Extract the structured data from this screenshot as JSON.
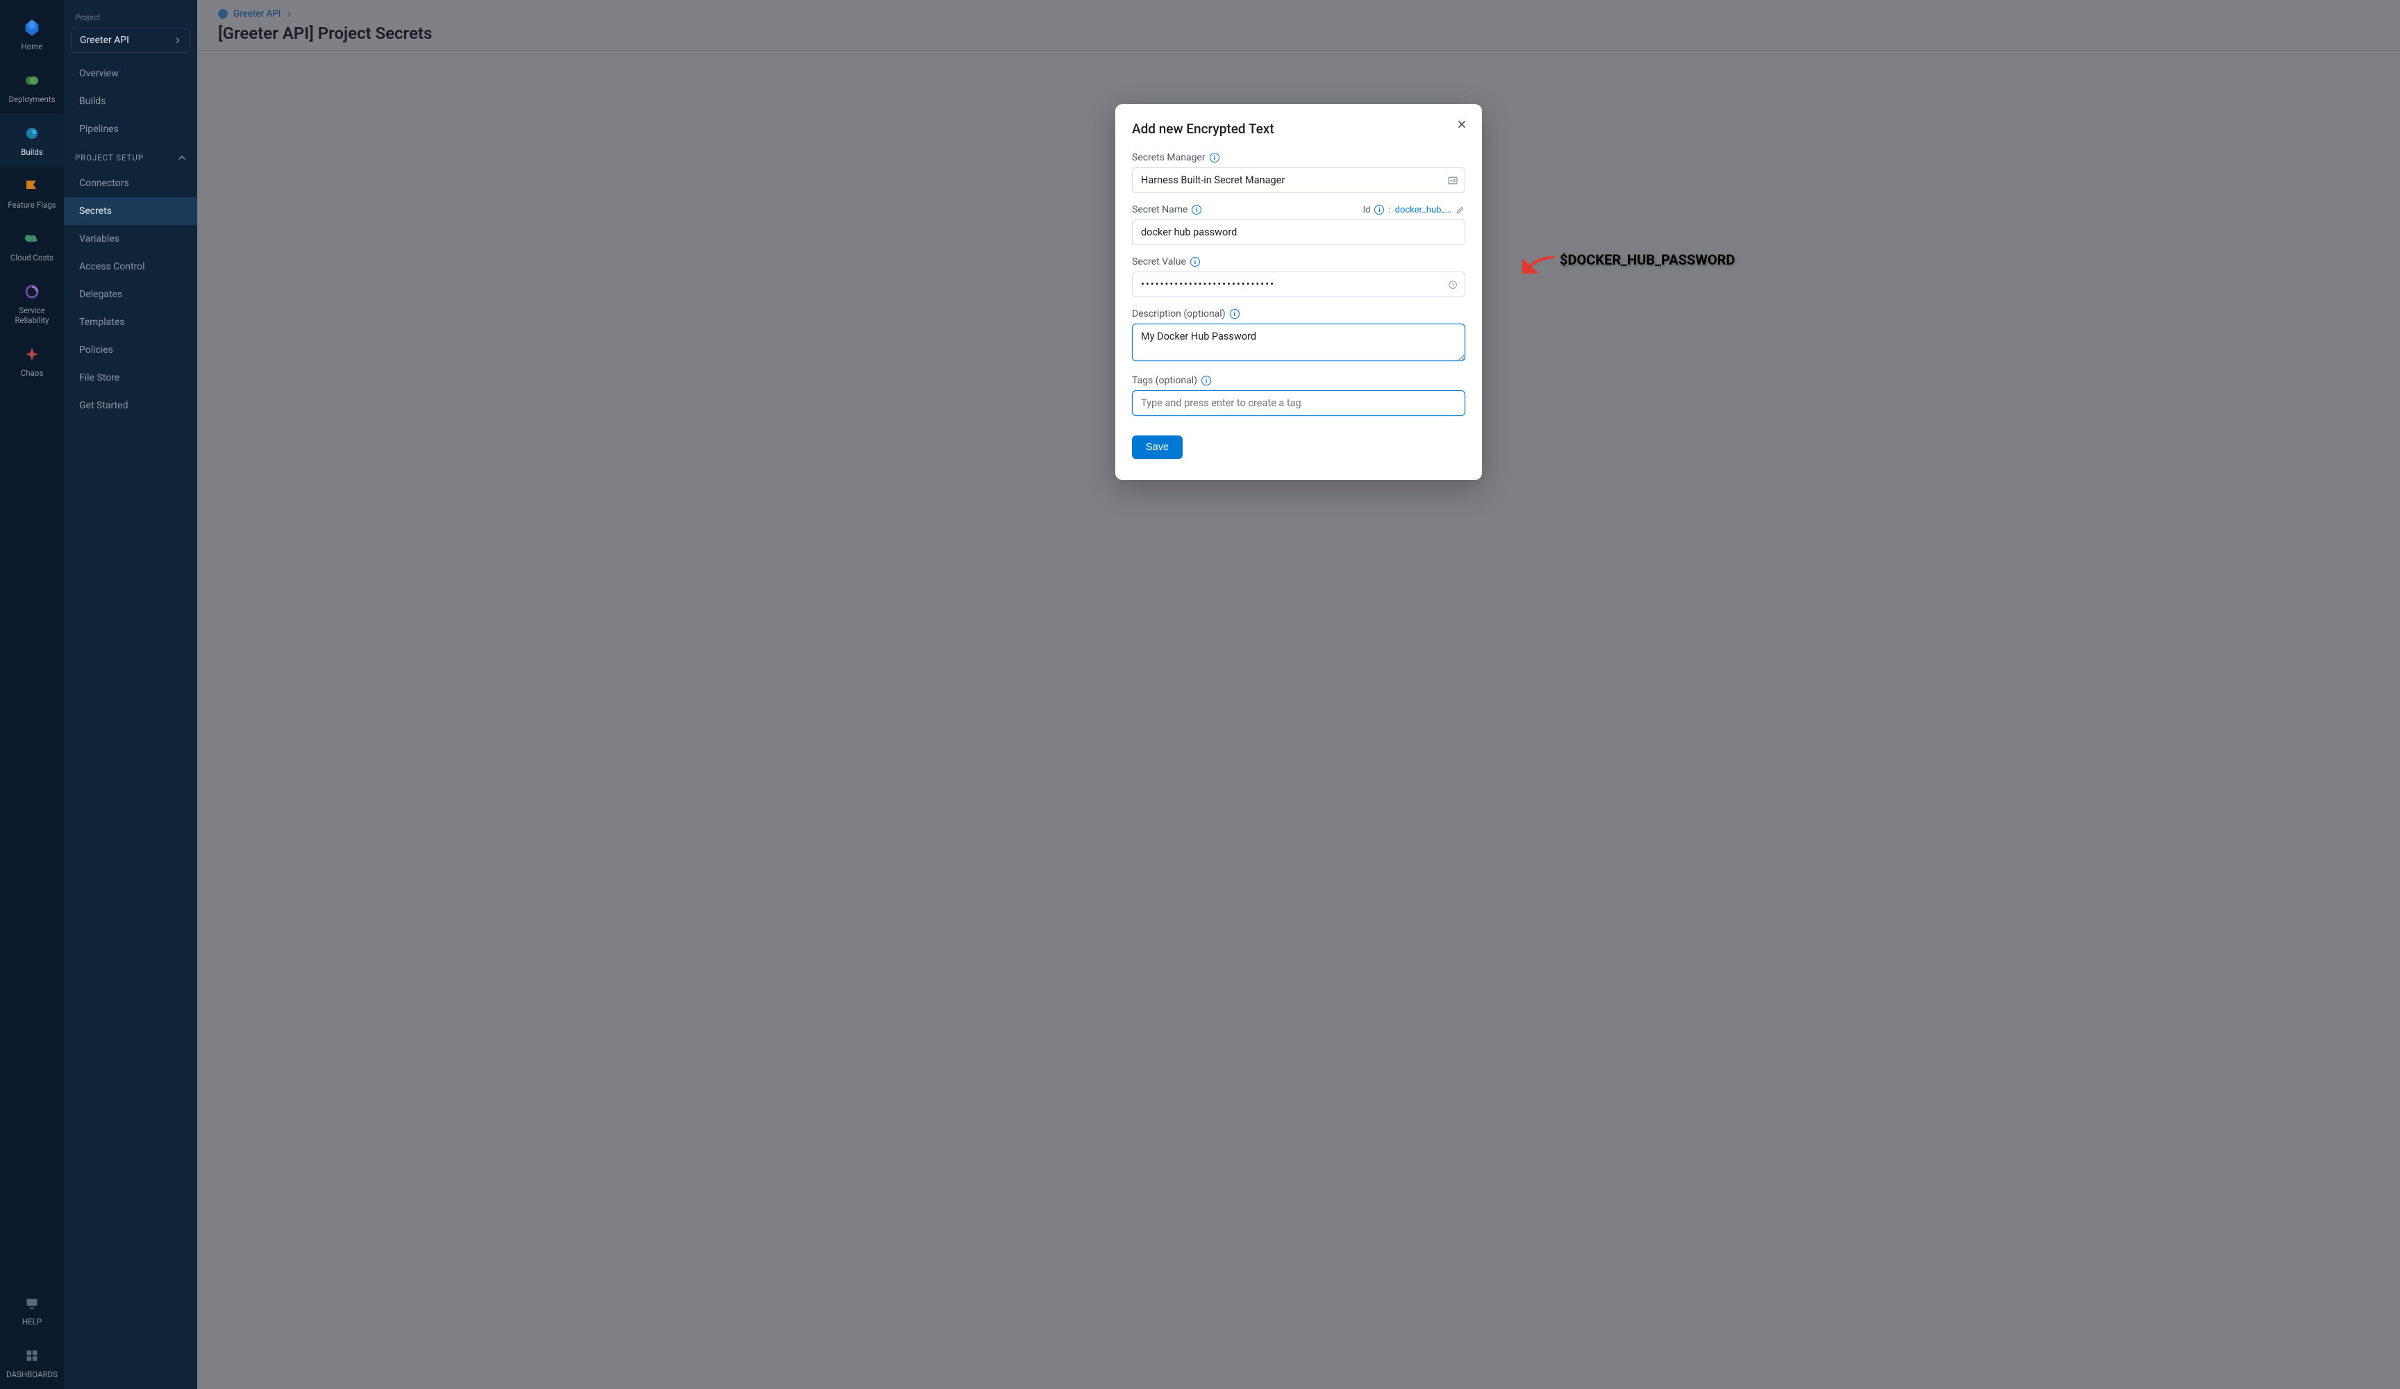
{
  "iconbar": {
    "items": [
      {
        "label": "Home"
      },
      {
        "label": "Deployments"
      },
      {
        "label": "Builds"
      },
      {
        "label": "Feature Flags"
      },
      {
        "label": "Cloud Costs"
      },
      {
        "label": "Service Reliability"
      },
      {
        "label": "Chaos"
      }
    ],
    "bottom": [
      {
        "label": "HELP"
      },
      {
        "label": "DASHBOARDS"
      }
    ]
  },
  "sidebar": {
    "section_label": "Project",
    "project_name": "Greeter API",
    "items_main": [
      {
        "label": "Overview"
      },
      {
        "label": "Builds"
      },
      {
        "label": "Pipelines"
      }
    ],
    "group_header": "PROJECT SETUP",
    "items_setup": [
      {
        "label": "Connectors"
      },
      {
        "label": "Secrets",
        "active": true
      },
      {
        "label": "Variables"
      },
      {
        "label": "Access Control"
      },
      {
        "label": "Delegates"
      },
      {
        "label": "Templates"
      },
      {
        "label": "Policies"
      },
      {
        "label": "File Store"
      },
      {
        "label": "Get Started"
      }
    ]
  },
  "header": {
    "breadcrumb_project": "Greeter API",
    "title": "[Greeter API] Project Secrets"
  },
  "modal": {
    "title": "Add new Encrypted Text",
    "secrets_manager": {
      "label": "Secrets Manager",
      "value": "Harness Built-in Secret Manager"
    },
    "secret_name": {
      "label": "Secret Name",
      "value": "docker hub password",
      "id_label": "Id",
      "id_value": "docker_hub_…"
    },
    "secret_value": {
      "label": "Secret Value",
      "value": "••••••••••••••••••••••••••••"
    },
    "description": {
      "label": "Description (optional)",
      "value": "My Docker Hub Password"
    },
    "tags": {
      "label": "Tags (optional)",
      "placeholder": "Type and press enter to create a tag"
    },
    "save_label": "Save",
    "annotation": "$DOCKER_HUB_PASSWORD"
  }
}
